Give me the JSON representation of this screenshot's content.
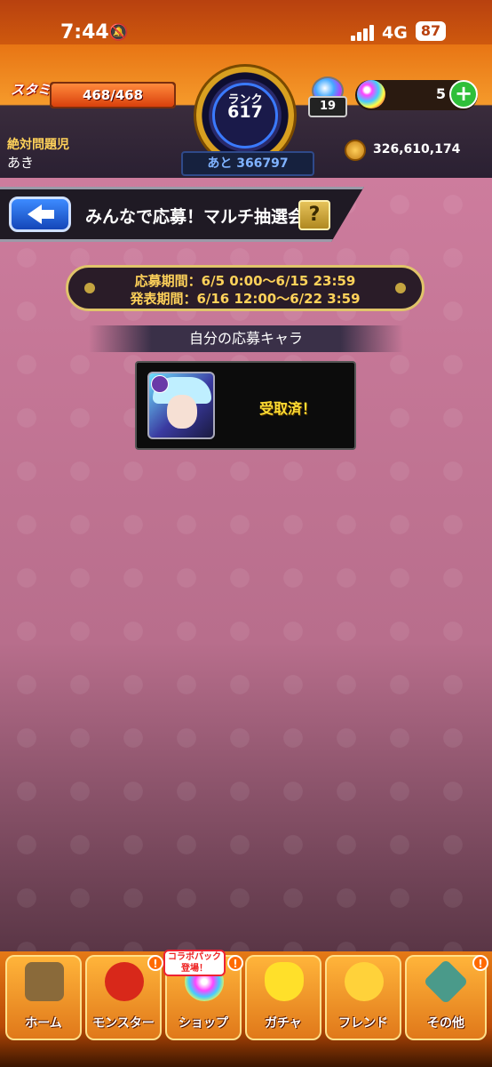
{
  "status_bar": {
    "time": "7:44",
    "network": "4G",
    "battery": "87"
  },
  "header": {
    "stamina_label": "スタミナ",
    "stamina_text": "468/468",
    "stamina_fraction": 1.0,
    "rank_label": "ランク",
    "rank_value": "617",
    "next_exp": "あと 366797",
    "mission_count": "19",
    "orb_count": "5",
    "user_title": "絶対問題児",
    "user_name": "あき",
    "coins": "326,610,174"
  },
  "page": {
    "title": "みんなで応募！マルチ抽選会",
    "help_label": "?",
    "period": {
      "entry": "応募期間：6/5 0:00～6/15 23:59",
      "announce": "発表期間：6/16 12:00～6/22 3:59"
    },
    "section_title": "自分の応募キャラ",
    "entry_status": "受取済！"
  },
  "nav": {
    "items": [
      {
        "label": "ホーム",
        "alert": ""
      },
      {
        "label": "モンスター",
        "alert": "!"
      },
      {
        "label": "ショップ",
        "alert": "!"
      },
      {
        "label": "ガチャ",
        "alert": ""
      },
      {
        "label": "フレンド",
        "alert": ""
      },
      {
        "label": "その他",
        "alert": "!"
      }
    ],
    "shop_tag": "コラボパック登場！"
  },
  "colors": {
    "accent": "#e87514",
    "background": "#c97a9a",
    "highlight": "#ffd25a"
  }
}
